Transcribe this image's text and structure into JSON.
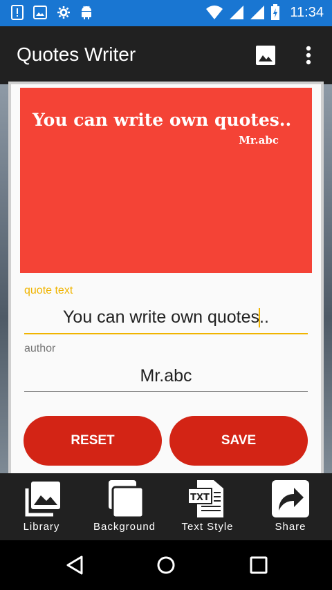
{
  "status_bar": {
    "time": "11:34",
    "icons": [
      "alert-icon",
      "image-icon",
      "settings-icon",
      "android-icon",
      "wifi-icon",
      "signal-icon",
      "signal-icon",
      "battery-charging-icon"
    ]
  },
  "app_bar": {
    "title": "Quotes Writer",
    "actions": [
      "image-icon",
      "more-vert-icon"
    ]
  },
  "preview": {
    "quote": "You can write own quotes..",
    "author": "Mr.abc",
    "background_color": "#f44336"
  },
  "form": {
    "quote_label": "quote text",
    "quote_value_before_cursor": "You can write own quotes",
    "quote_value_after_cursor": "..",
    "author_label": "author",
    "author_value": "Mr.abc"
  },
  "buttons": {
    "reset": "RESET",
    "save": "SAVE"
  },
  "toolbar": {
    "library": "Library",
    "background": "Background",
    "text_style": "Text Style",
    "share": "Share",
    "text_style_icon_text": "TXT"
  },
  "colors": {
    "accent": "#f0b400",
    "primary": "#1976d2",
    "button": "#d32415",
    "toolbar": "#212121"
  }
}
